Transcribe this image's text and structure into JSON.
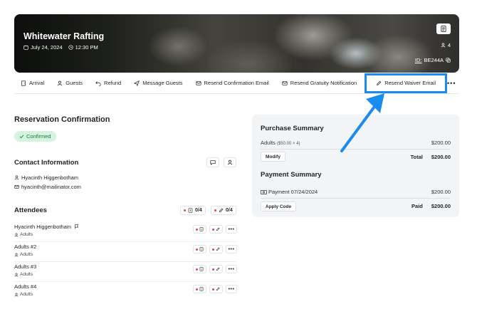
{
  "hero": {
    "title": "Whitewater Rafting",
    "date": "July 24, 2024",
    "time": "12:30 PM",
    "guest_count": "4",
    "id_label": "ID:",
    "id_value": "BE244A"
  },
  "tabs": [
    {
      "label": "Arrival",
      "icon": "door-icon"
    },
    {
      "label": "Guests",
      "icon": "user-icon"
    },
    {
      "label": "Refund",
      "icon": "refund-icon"
    },
    {
      "label": "Message Guests",
      "icon": "send-icon"
    },
    {
      "label": "Resend Confirmation Email",
      "icon": "mail-icon"
    },
    {
      "label": "Resend Gratuity Notification",
      "icon": "mail-icon"
    },
    {
      "label": "Resend Waiver Email",
      "icon": "pen-icon"
    }
  ],
  "highlight_color": "#1a8cf0",
  "reservation": {
    "title": "Reservation Confirmation",
    "status": "Confirmed"
  },
  "contact": {
    "title": "Contact Information",
    "name": "Hyacinth Higgenbotham",
    "email": "hyacinth@mailinator.com"
  },
  "attendees": {
    "title": "Attendees",
    "waiver_count": "0/4",
    "sign_count": "0/4",
    "rows": [
      {
        "name": "Hyacinth Higgenbotham",
        "type": "Adults",
        "flag": true
      },
      {
        "name": "Adults #2",
        "type": "Adults",
        "flag": false
      },
      {
        "name": "Adults #3",
        "type": "Adults",
        "flag": false
      },
      {
        "name": "Adults #4",
        "type": "Adults",
        "flag": false
      }
    ]
  },
  "purchase": {
    "title": "Purchase Summary",
    "item_label": "Adults",
    "item_detail": "($50.00 × 4)",
    "item_amount": "$200.00",
    "modify_label": "Modify",
    "total_label": "Total",
    "total_value": "$200.00"
  },
  "payment": {
    "title": "Payment Summary",
    "line_label": "Payment 07/24/2024",
    "line_amount": "$200.00",
    "apply_label": "Apply Code",
    "paid_label": "Paid",
    "paid_value": "$200.00"
  }
}
